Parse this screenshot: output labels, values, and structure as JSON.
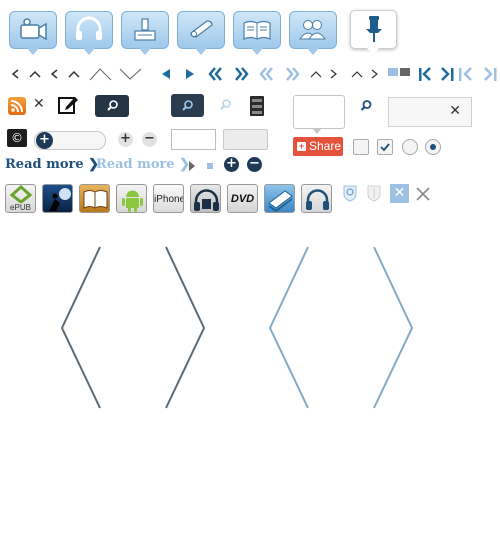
{
  "share": {
    "label": "Share",
    "plus": "+"
  },
  "copyright": {
    "symbol": "©"
  },
  "toggle": {
    "knob": "+"
  },
  "steppers": {
    "plus": "+",
    "minus": "−"
  },
  "read_more": {
    "primary": "Read more ❯",
    "secondary": "Read more ❯",
    "primary_color": "#1f4f7a",
    "secondary_color": "#9dbfe0"
  },
  "apps": {
    "epub_label": "ePUB",
    "iphone_label": "iPhone",
    "dvd_label": "DVD"
  },
  "close_glyph": "✕",
  "colors": {
    "accent": "#1f6b9e",
    "light_accent": "#9fc8ea",
    "dark": "#253544",
    "share": "#e4523c",
    "arrow_dark": "#5b6b7a",
    "arrow_light": "#86aac4"
  }
}
